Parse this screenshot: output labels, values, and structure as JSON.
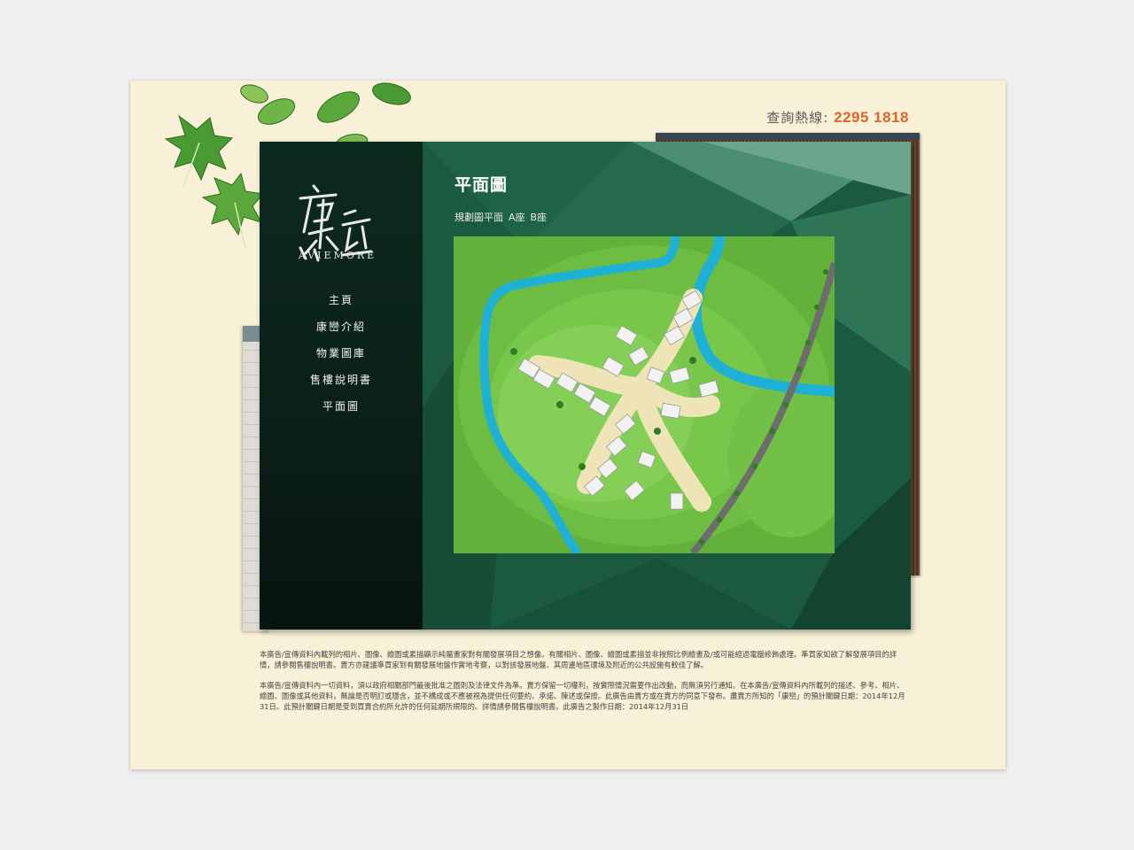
{
  "hotline": {
    "label": "查詢熱線:",
    "number": "2295 1818"
  },
  "brand": {
    "logo_text": "AVIEMORE",
    "logo_chinese": "康巒"
  },
  "nav": {
    "items": [
      "主頁",
      "康巒介紹",
      "物業圖庫",
      "售樓說明書",
      "平面圖"
    ]
  },
  "page": {
    "title": "平面圖",
    "tabs": [
      "規劃圖平面",
      "A座",
      "B座"
    ]
  },
  "disclaimer": {
    "p1": "本廣告/宣傳資料內載列的相片、圖像、繪圖或素描顯示純屬畫家對有關發展項目之想像。有關相片、圖像、繪圖或素描並非按照比例繪畫及/或可能經過電腦修飾處理。準買家如欲了解發展項目的詳情，請參閱售樓說明書。賣方亦建議準買家到有關發展地盤作實地考察，以對該發展地盤、其周邊地區環境及附近的公共設施有較佳了解。",
    "p2": "本廣告/宣傳資料內一切資料，須以政府相關部門最後批准之圖則及法律文件為準。賣方保留一切權利，按實際情況需要作出改動，而無須另行通知。在本廣告/宣傳資料內所載列的描述、參考、相片、繪圖、圖像或其他資料，無論是否明訂或隱含，並不構成或不應被視為提供任何要約、承諾、陳述或保證。此廣告由賣方或在賣方的同意下發布。盡賣方所知的「康巒」的預計關鍵日期：2014年12月31日。此預計關鍵日期是受到買賣合約所允許的任何延期所規限的。詳情請參閱售樓說明書。此廣告之製作日期：2014年12月31日"
  },
  "colors": {
    "accent": "#e0632a",
    "panel": "#1d5b41",
    "background": "#f8f1d7"
  }
}
